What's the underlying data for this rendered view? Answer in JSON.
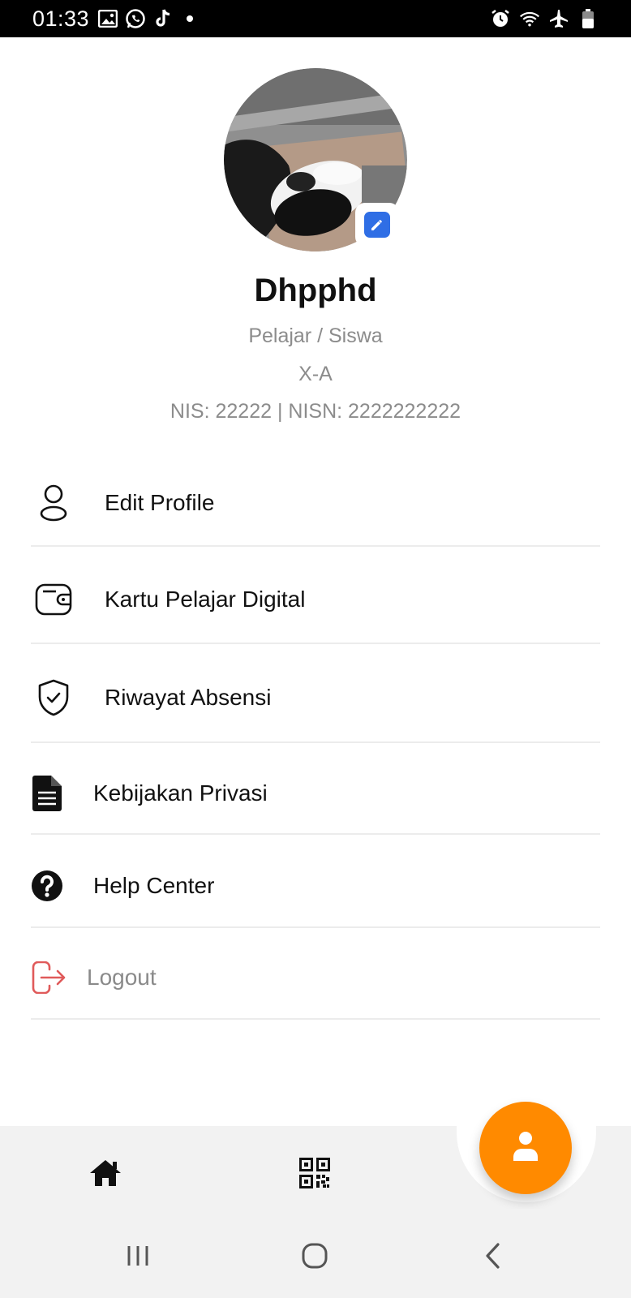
{
  "status_bar": {
    "time": "01:33",
    "left_icons": [
      "image-icon",
      "whatsapp-icon",
      "tiktok-icon",
      "dot-icon"
    ],
    "right_icons": [
      "alarm-icon",
      "wifi-icon",
      "airplane-icon",
      "battery-icon"
    ]
  },
  "profile": {
    "name": "Dhpphd",
    "role": "Pelajar / Siswa",
    "class": "X-A",
    "ids": "NIS: 22222 | NISN: 2222222222",
    "avatar_icon": "profile-photo",
    "edit_icon": "edit-icon",
    "edit_color": "#2f6ee5"
  },
  "menu": [
    {
      "label": "Edit Profile",
      "icon": "user-icon"
    },
    {
      "label": "Kartu Pelajar Digital",
      "icon": "wallet-icon"
    },
    {
      "label": "Riwayat Absensi",
      "icon": "shield-check-icon"
    },
    {
      "label": "Kebijakan Privasi",
      "icon": "document-icon"
    },
    {
      "label": "Help Center",
      "icon": "question-circle-icon"
    },
    {
      "label": "Logout",
      "icon": "logout-icon",
      "color": "#e05a5a"
    }
  ],
  "bottom_nav": {
    "items": [
      "home-icon",
      "qr-code-icon",
      "profile-icon"
    ],
    "active": "profile-icon",
    "accent": "#ff8a00"
  },
  "system_nav": [
    "recent-apps-icon",
    "home-circle-icon",
    "back-icon"
  ]
}
